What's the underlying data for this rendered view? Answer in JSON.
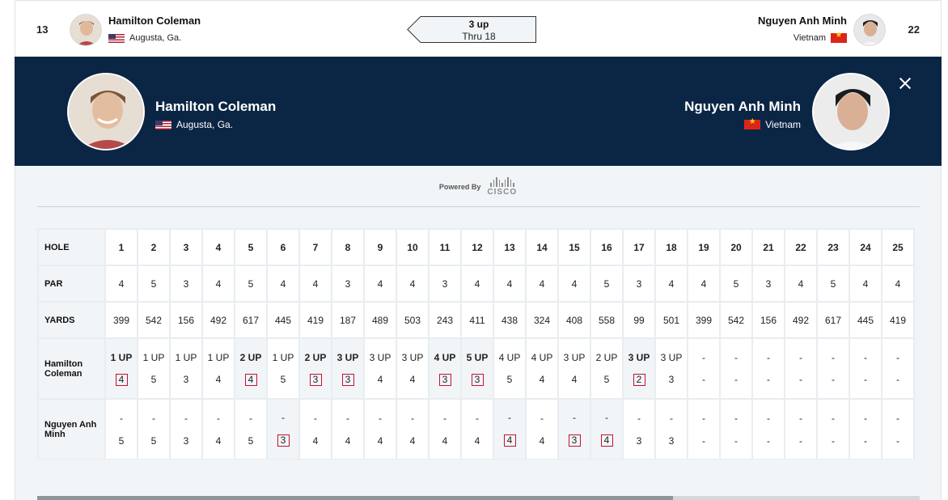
{
  "top": {
    "left_score": "13",
    "right_score": "22",
    "player1": {
      "name": "Hamilton Coleman",
      "location": "Augusta, Ga."
    },
    "player2": {
      "name": "Nguyen Anh Minh",
      "location": "Vietnam"
    },
    "status_line1": "3 up",
    "status_line2": "Thru 18"
  },
  "header": {
    "player1": {
      "name": "Hamilton Coleman",
      "location": "Augusta, Ga."
    },
    "player2": {
      "name": "Nguyen Anh Minh",
      "location": "Vietnam"
    }
  },
  "powered": {
    "label": "Powered By",
    "brand": "CISCO"
  },
  "colors": {
    "navy": "#0b2545",
    "score_box": "#c8102e",
    "panel": "#f1f5f8"
  },
  "scorecard": {
    "labels": {
      "hole": "HOLE",
      "par": "PAR",
      "yards": "YARDS",
      "p1": "Hamilton Coleman",
      "p2": "Nguyen Anh Minh"
    },
    "holes": [
      "1",
      "2",
      "3",
      "4",
      "5",
      "6",
      "7",
      "8",
      "9",
      "10",
      "11",
      "12",
      "13",
      "14",
      "15",
      "16",
      "17",
      "18",
      "19",
      "20",
      "21",
      "22",
      "23",
      "24",
      "25"
    ],
    "par": [
      "4",
      "5",
      "3",
      "4",
      "5",
      "4",
      "4",
      "3",
      "4",
      "4",
      "3",
      "4",
      "4",
      "4",
      "4",
      "5",
      "3",
      "4",
      "4",
      "5",
      "3",
      "4",
      "5",
      "4",
      "4"
    ],
    "yards": [
      "399",
      "542",
      "156",
      "492",
      "617",
      "445",
      "419",
      "187",
      "489",
      "503",
      "243",
      "411",
      "438",
      "324",
      "408",
      "558",
      "99",
      "501",
      "399",
      "542",
      "156",
      "492",
      "617",
      "445",
      "419"
    ],
    "p1_status": [
      "1 UP",
      "1 UP",
      "1 UP",
      "1 UP",
      "2 UP",
      "1 UP",
      "2 UP",
      "3 UP",
      "3 UP",
      "3 UP",
      "4 UP",
      "5 UP",
      "4 UP",
      "4 UP",
      "3 UP",
      "2 UP",
      "3 UP",
      "3 UP",
      "-",
      "-",
      "-",
      "-",
      "-",
      "-",
      "-"
    ],
    "p1_status_bold": [
      true,
      false,
      false,
      false,
      true,
      false,
      true,
      true,
      false,
      false,
      true,
      true,
      false,
      false,
      false,
      false,
      true,
      false,
      false,
      false,
      false,
      false,
      false,
      false,
      false
    ],
    "p1_scores": [
      "4",
      "5",
      "3",
      "4",
      "4",
      "5",
      "3",
      "3",
      "4",
      "4",
      "3",
      "3",
      "5",
      "4",
      "4",
      "5",
      "2",
      "3",
      "-",
      "-",
      "-",
      "-",
      "-",
      "-",
      "-"
    ],
    "p1_boxed": [
      true,
      false,
      false,
      false,
      true,
      false,
      true,
      true,
      false,
      false,
      true,
      true,
      false,
      false,
      false,
      false,
      true,
      false,
      false,
      false,
      false,
      false,
      false,
      false,
      false
    ],
    "p2_status": [
      "-",
      "-",
      "-",
      "-",
      "-",
      "-",
      "-",
      "-",
      "-",
      "-",
      "-",
      "-",
      "-",
      "-",
      "-",
      "-",
      "-",
      "-",
      "-",
      "-",
      "-",
      "-",
      "-",
      "-",
      "-"
    ],
    "p2_scores": [
      "5",
      "5",
      "3",
      "4",
      "5",
      "3",
      "4",
      "4",
      "4",
      "4",
      "4",
      "4",
      "4",
      "4",
      "3",
      "4",
      "3",
      "3",
      "-",
      "-",
      "-",
      "-",
      "-",
      "-",
      "-"
    ],
    "p2_boxed": [
      false,
      false,
      false,
      false,
      false,
      true,
      false,
      false,
      false,
      false,
      false,
      false,
      true,
      false,
      true,
      true,
      false,
      false,
      false,
      false,
      false,
      false,
      false,
      false,
      false
    ],
    "scroll_fraction": 0.72
  }
}
